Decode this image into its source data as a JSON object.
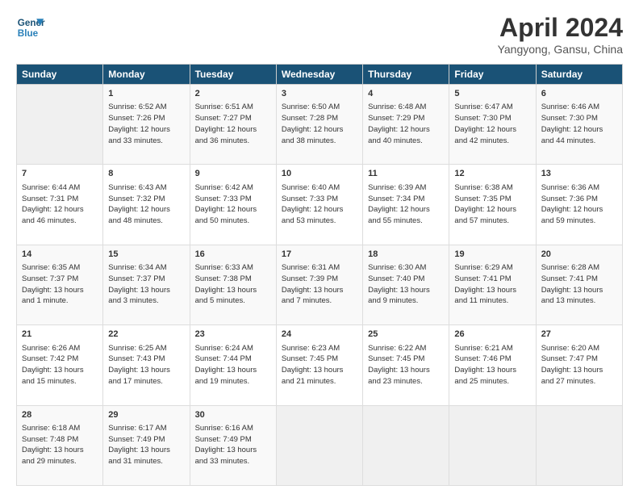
{
  "header": {
    "logo_line1": "General",
    "logo_line2": "Blue",
    "title": "April 2024",
    "subtitle": "Yangyong, Gansu, China"
  },
  "days_of_week": [
    "Sunday",
    "Monday",
    "Tuesday",
    "Wednesday",
    "Thursday",
    "Friday",
    "Saturday"
  ],
  "weeks": [
    [
      {
        "day": "",
        "info": ""
      },
      {
        "day": "1",
        "info": "Sunrise: 6:52 AM\nSunset: 7:26 PM\nDaylight: 12 hours\nand 33 minutes."
      },
      {
        "day": "2",
        "info": "Sunrise: 6:51 AM\nSunset: 7:27 PM\nDaylight: 12 hours\nand 36 minutes."
      },
      {
        "day": "3",
        "info": "Sunrise: 6:50 AM\nSunset: 7:28 PM\nDaylight: 12 hours\nand 38 minutes."
      },
      {
        "day": "4",
        "info": "Sunrise: 6:48 AM\nSunset: 7:29 PM\nDaylight: 12 hours\nand 40 minutes."
      },
      {
        "day": "5",
        "info": "Sunrise: 6:47 AM\nSunset: 7:30 PM\nDaylight: 12 hours\nand 42 minutes."
      },
      {
        "day": "6",
        "info": "Sunrise: 6:46 AM\nSunset: 7:30 PM\nDaylight: 12 hours\nand 44 minutes."
      }
    ],
    [
      {
        "day": "7",
        "info": "Sunrise: 6:44 AM\nSunset: 7:31 PM\nDaylight: 12 hours\nand 46 minutes."
      },
      {
        "day": "8",
        "info": "Sunrise: 6:43 AM\nSunset: 7:32 PM\nDaylight: 12 hours\nand 48 minutes."
      },
      {
        "day": "9",
        "info": "Sunrise: 6:42 AM\nSunset: 7:33 PM\nDaylight: 12 hours\nand 50 minutes."
      },
      {
        "day": "10",
        "info": "Sunrise: 6:40 AM\nSunset: 7:33 PM\nDaylight: 12 hours\nand 53 minutes."
      },
      {
        "day": "11",
        "info": "Sunrise: 6:39 AM\nSunset: 7:34 PM\nDaylight: 12 hours\nand 55 minutes."
      },
      {
        "day": "12",
        "info": "Sunrise: 6:38 AM\nSunset: 7:35 PM\nDaylight: 12 hours\nand 57 minutes."
      },
      {
        "day": "13",
        "info": "Sunrise: 6:36 AM\nSunset: 7:36 PM\nDaylight: 12 hours\nand 59 minutes."
      }
    ],
    [
      {
        "day": "14",
        "info": "Sunrise: 6:35 AM\nSunset: 7:37 PM\nDaylight: 13 hours\nand 1 minute."
      },
      {
        "day": "15",
        "info": "Sunrise: 6:34 AM\nSunset: 7:37 PM\nDaylight: 13 hours\nand 3 minutes."
      },
      {
        "day": "16",
        "info": "Sunrise: 6:33 AM\nSunset: 7:38 PM\nDaylight: 13 hours\nand 5 minutes."
      },
      {
        "day": "17",
        "info": "Sunrise: 6:31 AM\nSunset: 7:39 PM\nDaylight: 13 hours\nand 7 minutes."
      },
      {
        "day": "18",
        "info": "Sunrise: 6:30 AM\nSunset: 7:40 PM\nDaylight: 13 hours\nand 9 minutes."
      },
      {
        "day": "19",
        "info": "Sunrise: 6:29 AM\nSunset: 7:41 PM\nDaylight: 13 hours\nand 11 minutes."
      },
      {
        "day": "20",
        "info": "Sunrise: 6:28 AM\nSunset: 7:41 PM\nDaylight: 13 hours\nand 13 minutes."
      }
    ],
    [
      {
        "day": "21",
        "info": "Sunrise: 6:26 AM\nSunset: 7:42 PM\nDaylight: 13 hours\nand 15 minutes."
      },
      {
        "day": "22",
        "info": "Sunrise: 6:25 AM\nSunset: 7:43 PM\nDaylight: 13 hours\nand 17 minutes."
      },
      {
        "day": "23",
        "info": "Sunrise: 6:24 AM\nSunset: 7:44 PM\nDaylight: 13 hours\nand 19 minutes."
      },
      {
        "day": "24",
        "info": "Sunrise: 6:23 AM\nSunset: 7:45 PM\nDaylight: 13 hours\nand 21 minutes."
      },
      {
        "day": "25",
        "info": "Sunrise: 6:22 AM\nSunset: 7:45 PM\nDaylight: 13 hours\nand 23 minutes."
      },
      {
        "day": "26",
        "info": "Sunrise: 6:21 AM\nSunset: 7:46 PM\nDaylight: 13 hours\nand 25 minutes."
      },
      {
        "day": "27",
        "info": "Sunrise: 6:20 AM\nSunset: 7:47 PM\nDaylight: 13 hours\nand 27 minutes."
      }
    ],
    [
      {
        "day": "28",
        "info": "Sunrise: 6:18 AM\nSunset: 7:48 PM\nDaylight: 13 hours\nand 29 minutes."
      },
      {
        "day": "29",
        "info": "Sunrise: 6:17 AM\nSunset: 7:49 PM\nDaylight: 13 hours\nand 31 minutes."
      },
      {
        "day": "30",
        "info": "Sunrise: 6:16 AM\nSunset: 7:49 PM\nDaylight: 13 hours\nand 33 minutes."
      },
      {
        "day": "",
        "info": ""
      },
      {
        "day": "",
        "info": ""
      },
      {
        "day": "",
        "info": ""
      },
      {
        "day": "",
        "info": ""
      }
    ]
  ]
}
